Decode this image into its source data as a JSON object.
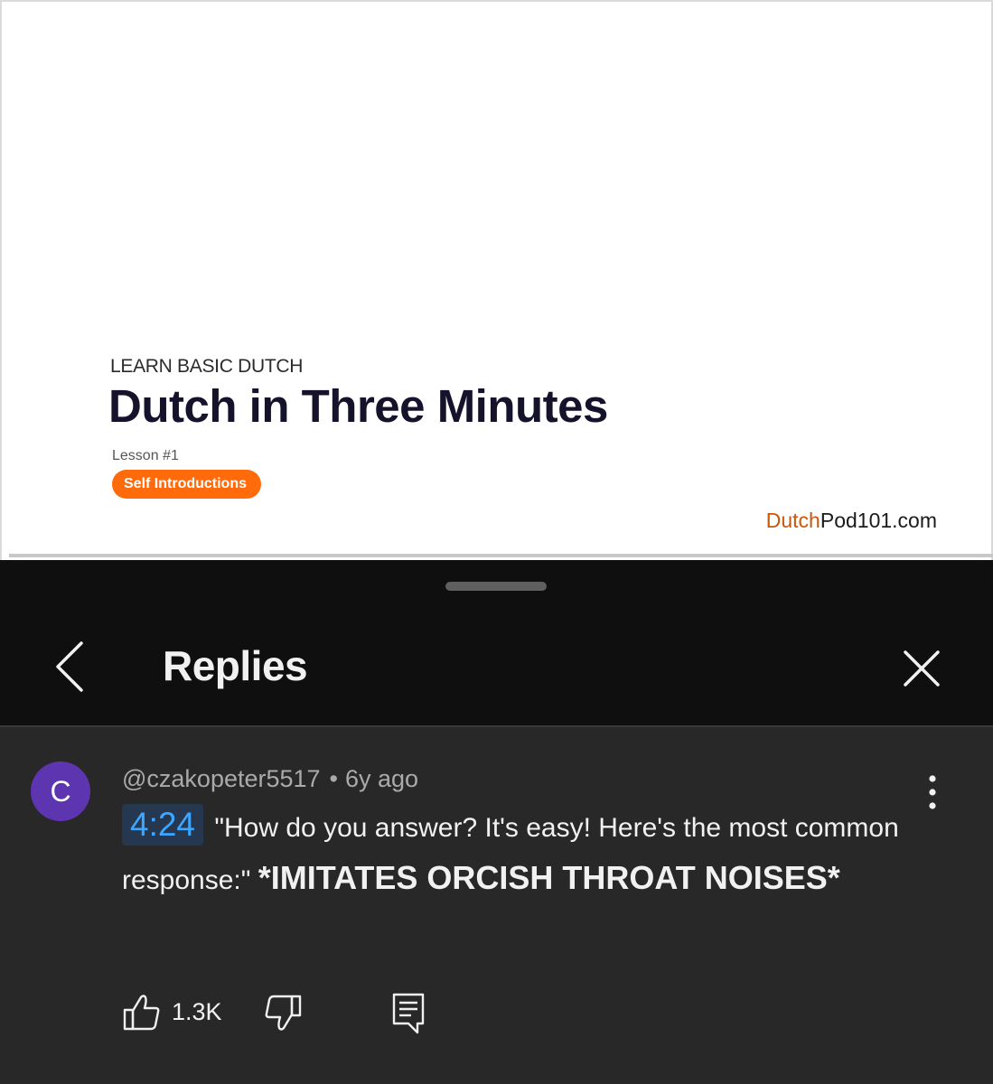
{
  "video": {
    "kicker": "LEARN BASIC DUTCH",
    "title": "Dutch in Three Minutes",
    "lesson": "Lesson #1",
    "topic": "Self Introductions",
    "brand_part1": "Dutch",
    "brand_part2": "Pod101.com",
    "topic_color": "#ff6b0b",
    "brand_accent": "#c9570e"
  },
  "sheet": {
    "title": "Replies",
    "back_icon": "chevron-left-icon",
    "close_icon": "close-icon"
  },
  "comment": {
    "avatar_letter": "C",
    "avatar_color": "#5e35b1",
    "author": "@czakopeter5517",
    "separator": "•",
    "age": "6y ago",
    "timestamp": "4:24",
    "text": "\"How do you answer? It's easy! Here's the most common response:\"",
    "text_bold": "*IMITATES ORCISH THROAT NOISES*",
    "like_count": "1.3K",
    "icons": {
      "more": "more-vertical-icon",
      "like": "thumbs-up-icon",
      "dislike": "thumbs-down-icon",
      "reply": "reply-comment-icon"
    }
  }
}
